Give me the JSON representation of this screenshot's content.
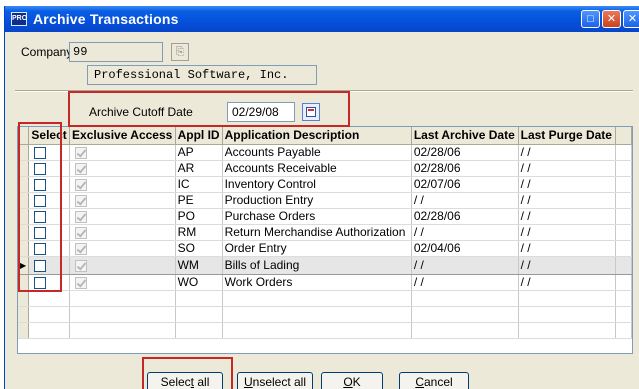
{
  "window": {
    "title": "Archive Transactions",
    "app_badge": "PRO"
  },
  "company": {
    "label": "Company",
    "code": "99",
    "name": "Professional Software, Inc."
  },
  "cutoff": {
    "label": "Archive Cutoff Date",
    "value": "02/29/08"
  },
  "grid": {
    "columns": [
      "Select",
      "Exclusive Access",
      "Appl ID",
      "Application Description",
      "Last Archive Date",
      "Last Purge Date"
    ],
    "rows": [
      {
        "appl_id": "AP",
        "description": "Accounts Payable",
        "last_archive": "02/28/06",
        "last_purge": "/ /",
        "selected": false,
        "exclusive": true
      },
      {
        "appl_id": "AR",
        "description": "Accounts Receivable",
        "last_archive": "02/28/06",
        "last_purge": "/ /",
        "selected": false,
        "exclusive": true
      },
      {
        "appl_id": "IC",
        "description": "Inventory Control",
        "last_archive": "02/07/06",
        "last_purge": "/ /",
        "selected": false,
        "exclusive": true
      },
      {
        "appl_id": "PE",
        "description": "Production Entry",
        "last_archive": "/ /",
        "last_purge": "/ /",
        "selected": false,
        "exclusive": true
      },
      {
        "appl_id": "PO",
        "description": "Purchase Orders",
        "last_archive": "02/28/06",
        "last_purge": "/ /",
        "selected": false,
        "exclusive": true
      },
      {
        "appl_id": "RM",
        "description": "Return Merchandise Authorization",
        "last_archive": "/ /",
        "last_purge": "/ /",
        "selected": false,
        "exclusive": true
      },
      {
        "appl_id": "SO",
        "description": "Order Entry",
        "last_archive": "02/04/06",
        "last_purge": "/ /",
        "selected": false,
        "exclusive": true
      },
      {
        "appl_id": "WM",
        "description": "Bills of Lading",
        "last_archive": "/ /",
        "last_purge": "/ /",
        "selected": false,
        "exclusive": true
      },
      {
        "appl_id": "WO",
        "description": "Work Orders",
        "last_archive": "/ /",
        "last_purge": "/ /",
        "selected": false,
        "exclusive": true
      }
    ],
    "current_row": 7
  },
  "buttons": {
    "select_all": {
      "pre": "Selec",
      "key": "t",
      "post": " all"
    },
    "unselect_all": {
      "pre": "",
      "key": "U",
      "post": "nselect all"
    },
    "ok": {
      "pre": "",
      "key": "O",
      "post": "K"
    },
    "cancel": {
      "pre": "",
      "key": "C",
      "post": "ancel"
    }
  }
}
